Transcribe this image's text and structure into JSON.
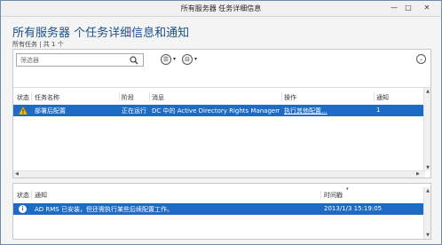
{
  "window": {
    "title": "所有服务器 任务详细信息",
    "min_glyph": "—",
    "max_glyph": "□",
    "close_glyph": "✕"
  },
  "page": {
    "title": "所有服务器 个任务详细信息和通知",
    "subtitle": "所有任务 | 共 1 个"
  },
  "toolbar": {
    "filter_placeholder": "筛选器",
    "list_glyph": "☰",
    "save_glyph": "⊟",
    "caret_glyph": "▾",
    "expand_glyph": "⌄"
  },
  "tasks_table": {
    "columns": [
      "状态",
      "任务名称",
      "阶段",
      "消息",
      "操作",
      "通知"
    ],
    "rows": [
      {
        "status_icon": "warning-icon",
        "name": "部署后配置",
        "stage": "正在运行",
        "message": "DC 中的 Active Directory Rights Manageme...",
        "action": "执行其他配置...",
        "notifications": "1"
      }
    ]
  },
  "notifications_table": {
    "columns": [
      "状态",
      "通知",
      "时间戳"
    ],
    "rows": [
      {
        "status_icon": "info-icon",
        "message": "AD RMS 已安装，但还需执行某些后续配置工作。",
        "timestamp": "2013/1/3 15:19:05"
      }
    ]
  },
  "colors": {
    "title_blue": "#1b4f8a",
    "selection_blue": "#1e6bc5",
    "warning_yellow": "#f2c200"
  }
}
